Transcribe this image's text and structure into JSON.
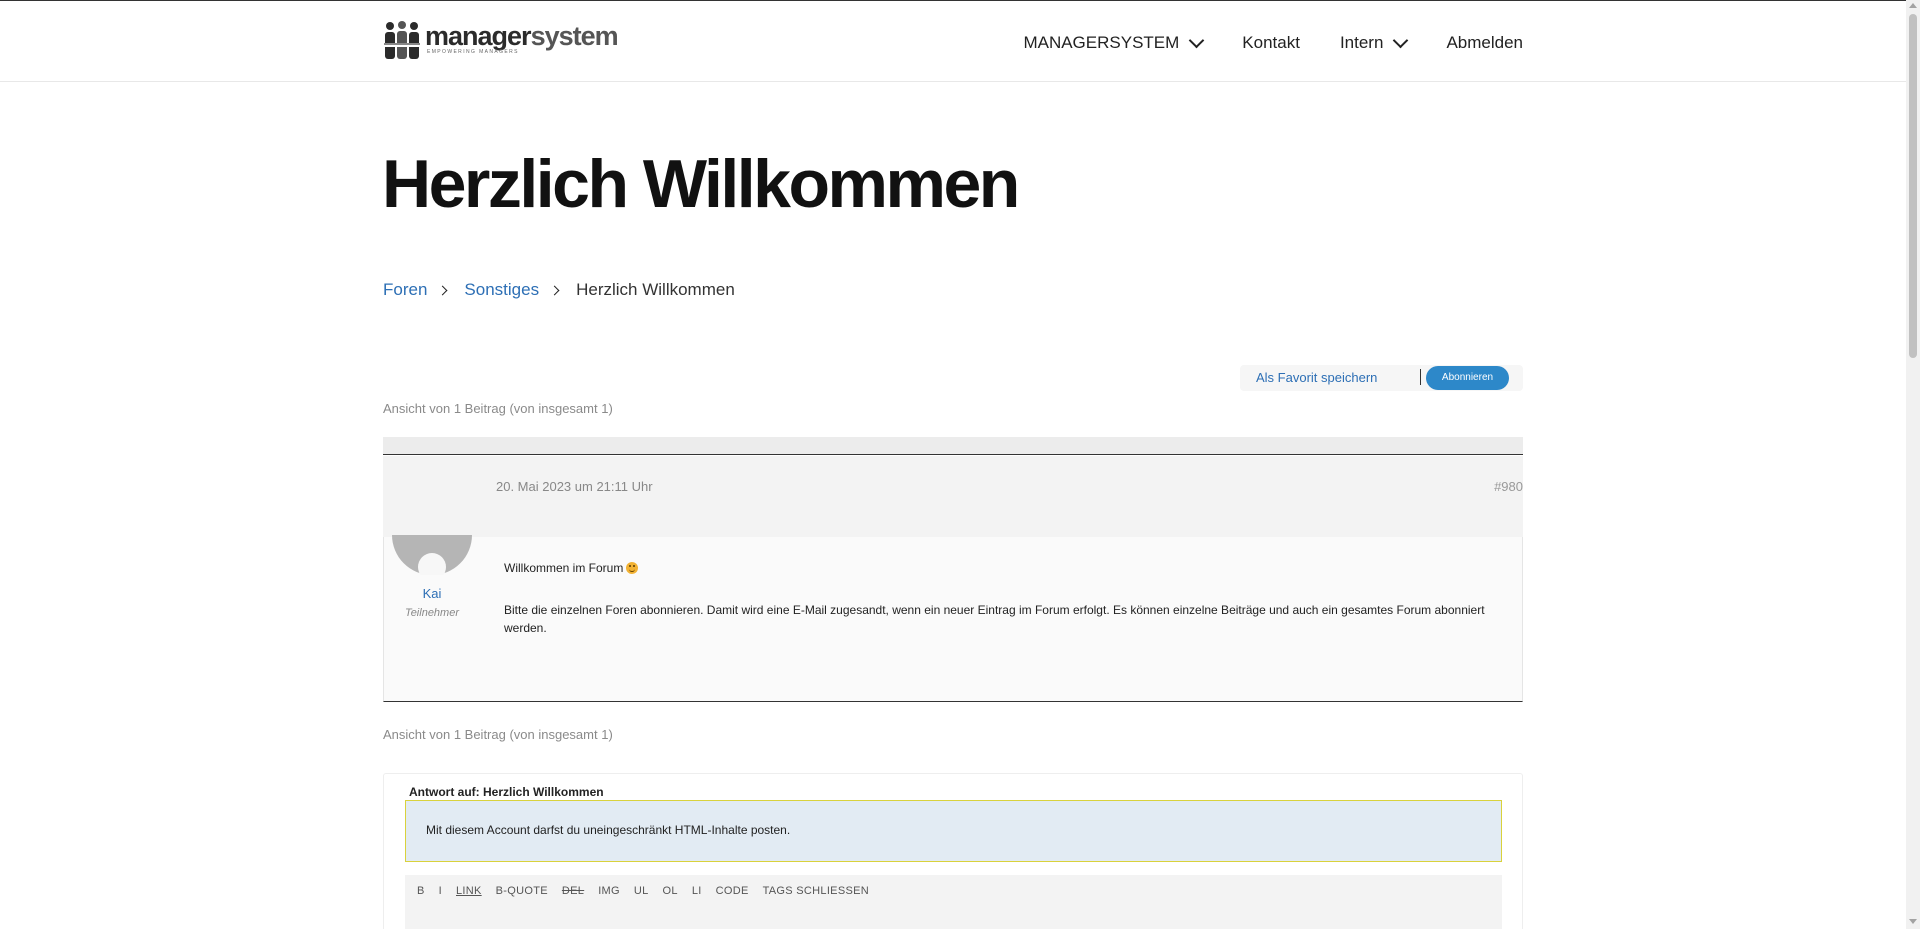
{
  "header": {
    "logo": {
      "word_a": "manager",
      "word_b": "system",
      "tagline": "EMPOWERING MANAGERS"
    },
    "nav": [
      {
        "label": "MANAGERSYSTEM",
        "has_dropdown": true
      },
      {
        "label": "Kontakt",
        "has_dropdown": false
      },
      {
        "label": "Intern",
        "has_dropdown": true
      },
      {
        "label": "Abmelden",
        "has_dropdown": false
      }
    ]
  },
  "page": {
    "title": "Herzlich Willkommen"
  },
  "breadcrumb": {
    "items": [
      "Foren",
      "Sonstiges"
    ],
    "current": "Herzlich Willkommen"
  },
  "actions": {
    "favorite_label": "Als Favorit speichern",
    "subscribe_label": "Abonnieren"
  },
  "counts": {
    "top": "Ansicht von 1 Beitrag (von insgesamt 1)",
    "bottom": "Ansicht von 1 Beitrag (von insgesamt 1)"
  },
  "post": {
    "date": "20. Mai 2023 um 21:11 Uhr",
    "number": "#980",
    "author": {
      "name": "Kai",
      "role": "Teilnehmer"
    },
    "paragraphs": [
      "Willkommen im Forum",
      "Bitte die einzelnen Foren abonnieren. Damit wird eine E-Mail zugesandt, wenn ein neuer Eintrag im Forum erfolgt. Es können einzelne Beiträge und auch ein gesamtes Forum abonniert werden."
    ],
    "emoji": "smiley-icon"
  },
  "reply": {
    "legend": "Antwort auf: Herzlich Willkommen",
    "notice": "Mit diesem Account darfst du uneingeschränkt HTML-Inhalte posten.",
    "toolbar": [
      "B",
      "I",
      "LINK",
      "B-QUOTE",
      "DEL",
      "IMG",
      "UL",
      "OL",
      "LI",
      "CODE",
      "TAGS SCHLIESSEN"
    ]
  },
  "colors": {
    "link": "#2d6fb5",
    "button": "#2d88c9",
    "notice_bg": "#e2ebf3",
    "notice_border": "#d9d23c"
  }
}
